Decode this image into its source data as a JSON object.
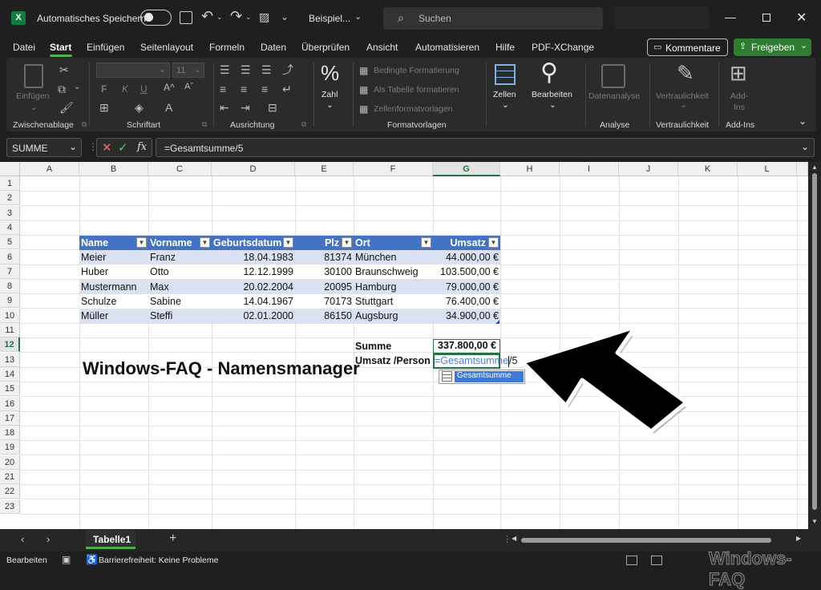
{
  "titlebar": {
    "autosave_label": "Automatisches Speichern",
    "filename": "Beispiel...",
    "search_placeholder": "Suchen"
  },
  "tabs": [
    "Datei",
    "Start",
    "Einfügen",
    "Seitenlayout",
    "Formeln",
    "Daten",
    "Überprüfen",
    "Ansicht",
    "Automatisieren",
    "Hilfe",
    "PDF-XChange"
  ],
  "actions": {
    "comments": "Kommentare",
    "share": "Freigeben"
  },
  "ribbon": {
    "paste": "Einfügen",
    "font_size": "11",
    "bold": "F",
    "italic": "K",
    "underline": "U",
    "number_label": "Zahl",
    "cond_format": "Bedingte Formatierung",
    "as_table": "Als Tabelle formatieren",
    "cell_styles": "Zellenformatvorlagen",
    "cells": "Zellen",
    "edit": "Bearbeiten",
    "analyze": "Datenanalyse",
    "sensitivity": "Vertraulichkeit",
    "addins_line1": "Add-",
    "addins_line2": "Ins",
    "groups": [
      "Zwischenablage",
      "Schriftart",
      "Ausrichtung",
      "Formatvorlagen",
      "Analyse",
      "Vertraulichkeit",
      "Add-Ins"
    ]
  },
  "formula_bar": {
    "name_box": "SUMME",
    "formula": "=Gesamtsumme/5"
  },
  "columns": [
    "A",
    "B",
    "C",
    "D",
    "E",
    "F",
    "G",
    "H",
    "I",
    "J",
    "K",
    "L"
  ],
  "rows": [
    "1",
    "2",
    "3",
    "4",
    "5",
    "6",
    "7",
    "8",
    "9",
    "10",
    "11",
    "12",
    "13",
    "14",
    "15",
    "16",
    "17",
    "18",
    "19",
    "20",
    "21",
    "22",
    "23"
  ],
  "sheet": {
    "title": "Windows-FAQ - Namensmanager",
    "headers": [
      "Name",
      "Vorname",
      "Geburtsdatum",
      "Plz",
      "Ort",
      "Umsatz"
    ],
    "table": [
      [
        "Meier",
        "Franz",
        "18.04.1983",
        "81374",
        "München",
        "44.000,00 €"
      ],
      [
        "Huber",
        "Otto",
        "12.12.1999",
        "30100",
        "Braunschweig",
        "103.500,00 €"
      ],
      [
        "Mustermann",
        "Max",
        "20.02.2004",
        "20095",
        "Hamburg",
        "79.000,00 €"
      ],
      [
        "Schulze",
        "Sabine",
        "14.04.1967",
        "70173",
        "Stuttgart",
        "76.400,00 €"
      ],
      [
        "Müller",
        "Steffi",
        "02.01.2000",
        "86150",
        "Augsburg",
        "34.900,00 €"
      ]
    ],
    "sum_label": "Summe",
    "sum_value": "337.800,00 €",
    "per_person_label": "Umsatz /Person",
    "edit_formula_name": "=Gesamtsumme",
    "edit_formula_rest": "/5",
    "autocomplete": "Gesamtsumme"
  },
  "sheet_tab": "Tabelle1",
  "status": {
    "mode": "Bearbeiten",
    "accessibility": "Barrierefreiheit: Keine Probleme"
  },
  "watermark": "Windows-FAQ",
  "colors": {
    "accent": "#217346",
    "table_header": "#4472c4",
    "band": "#d9e1f2",
    "share": "#2e7d32"
  }
}
